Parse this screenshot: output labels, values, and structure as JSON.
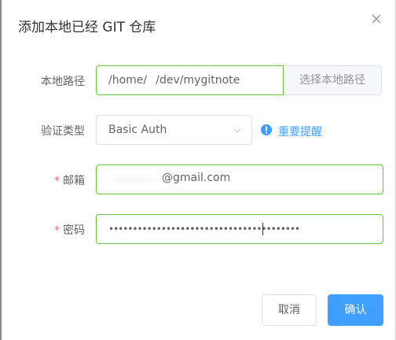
{
  "dialog": {
    "title": "添加本地已经 GIT 仓库"
  },
  "form": {
    "local_path": {
      "label": "本地路径",
      "value": "/home/    /dev/mygitnote",
      "button_label": "选择本地路径"
    },
    "auth_type": {
      "label": "验证类型",
      "value": "Basic Auth",
      "warning_link": "重要提醒"
    },
    "email": {
      "label": "邮箱",
      "required_mark": "*",
      "value_suffix": "@gmail.com"
    },
    "password": {
      "label": "密码",
      "required_mark": "*",
      "value": "••••••••••••••••••••••••••••••••••••••••"
    }
  },
  "footer": {
    "cancel_label": "取消",
    "confirm_label": "确认"
  },
  "colors": {
    "primary": "#409eff",
    "success_border": "#67c23a",
    "danger": "#f56c6c"
  },
  "icons": {
    "close": "close-icon",
    "select_arrow": "chevron-down-icon",
    "warning": "warning-circle-icon"
  }
}
